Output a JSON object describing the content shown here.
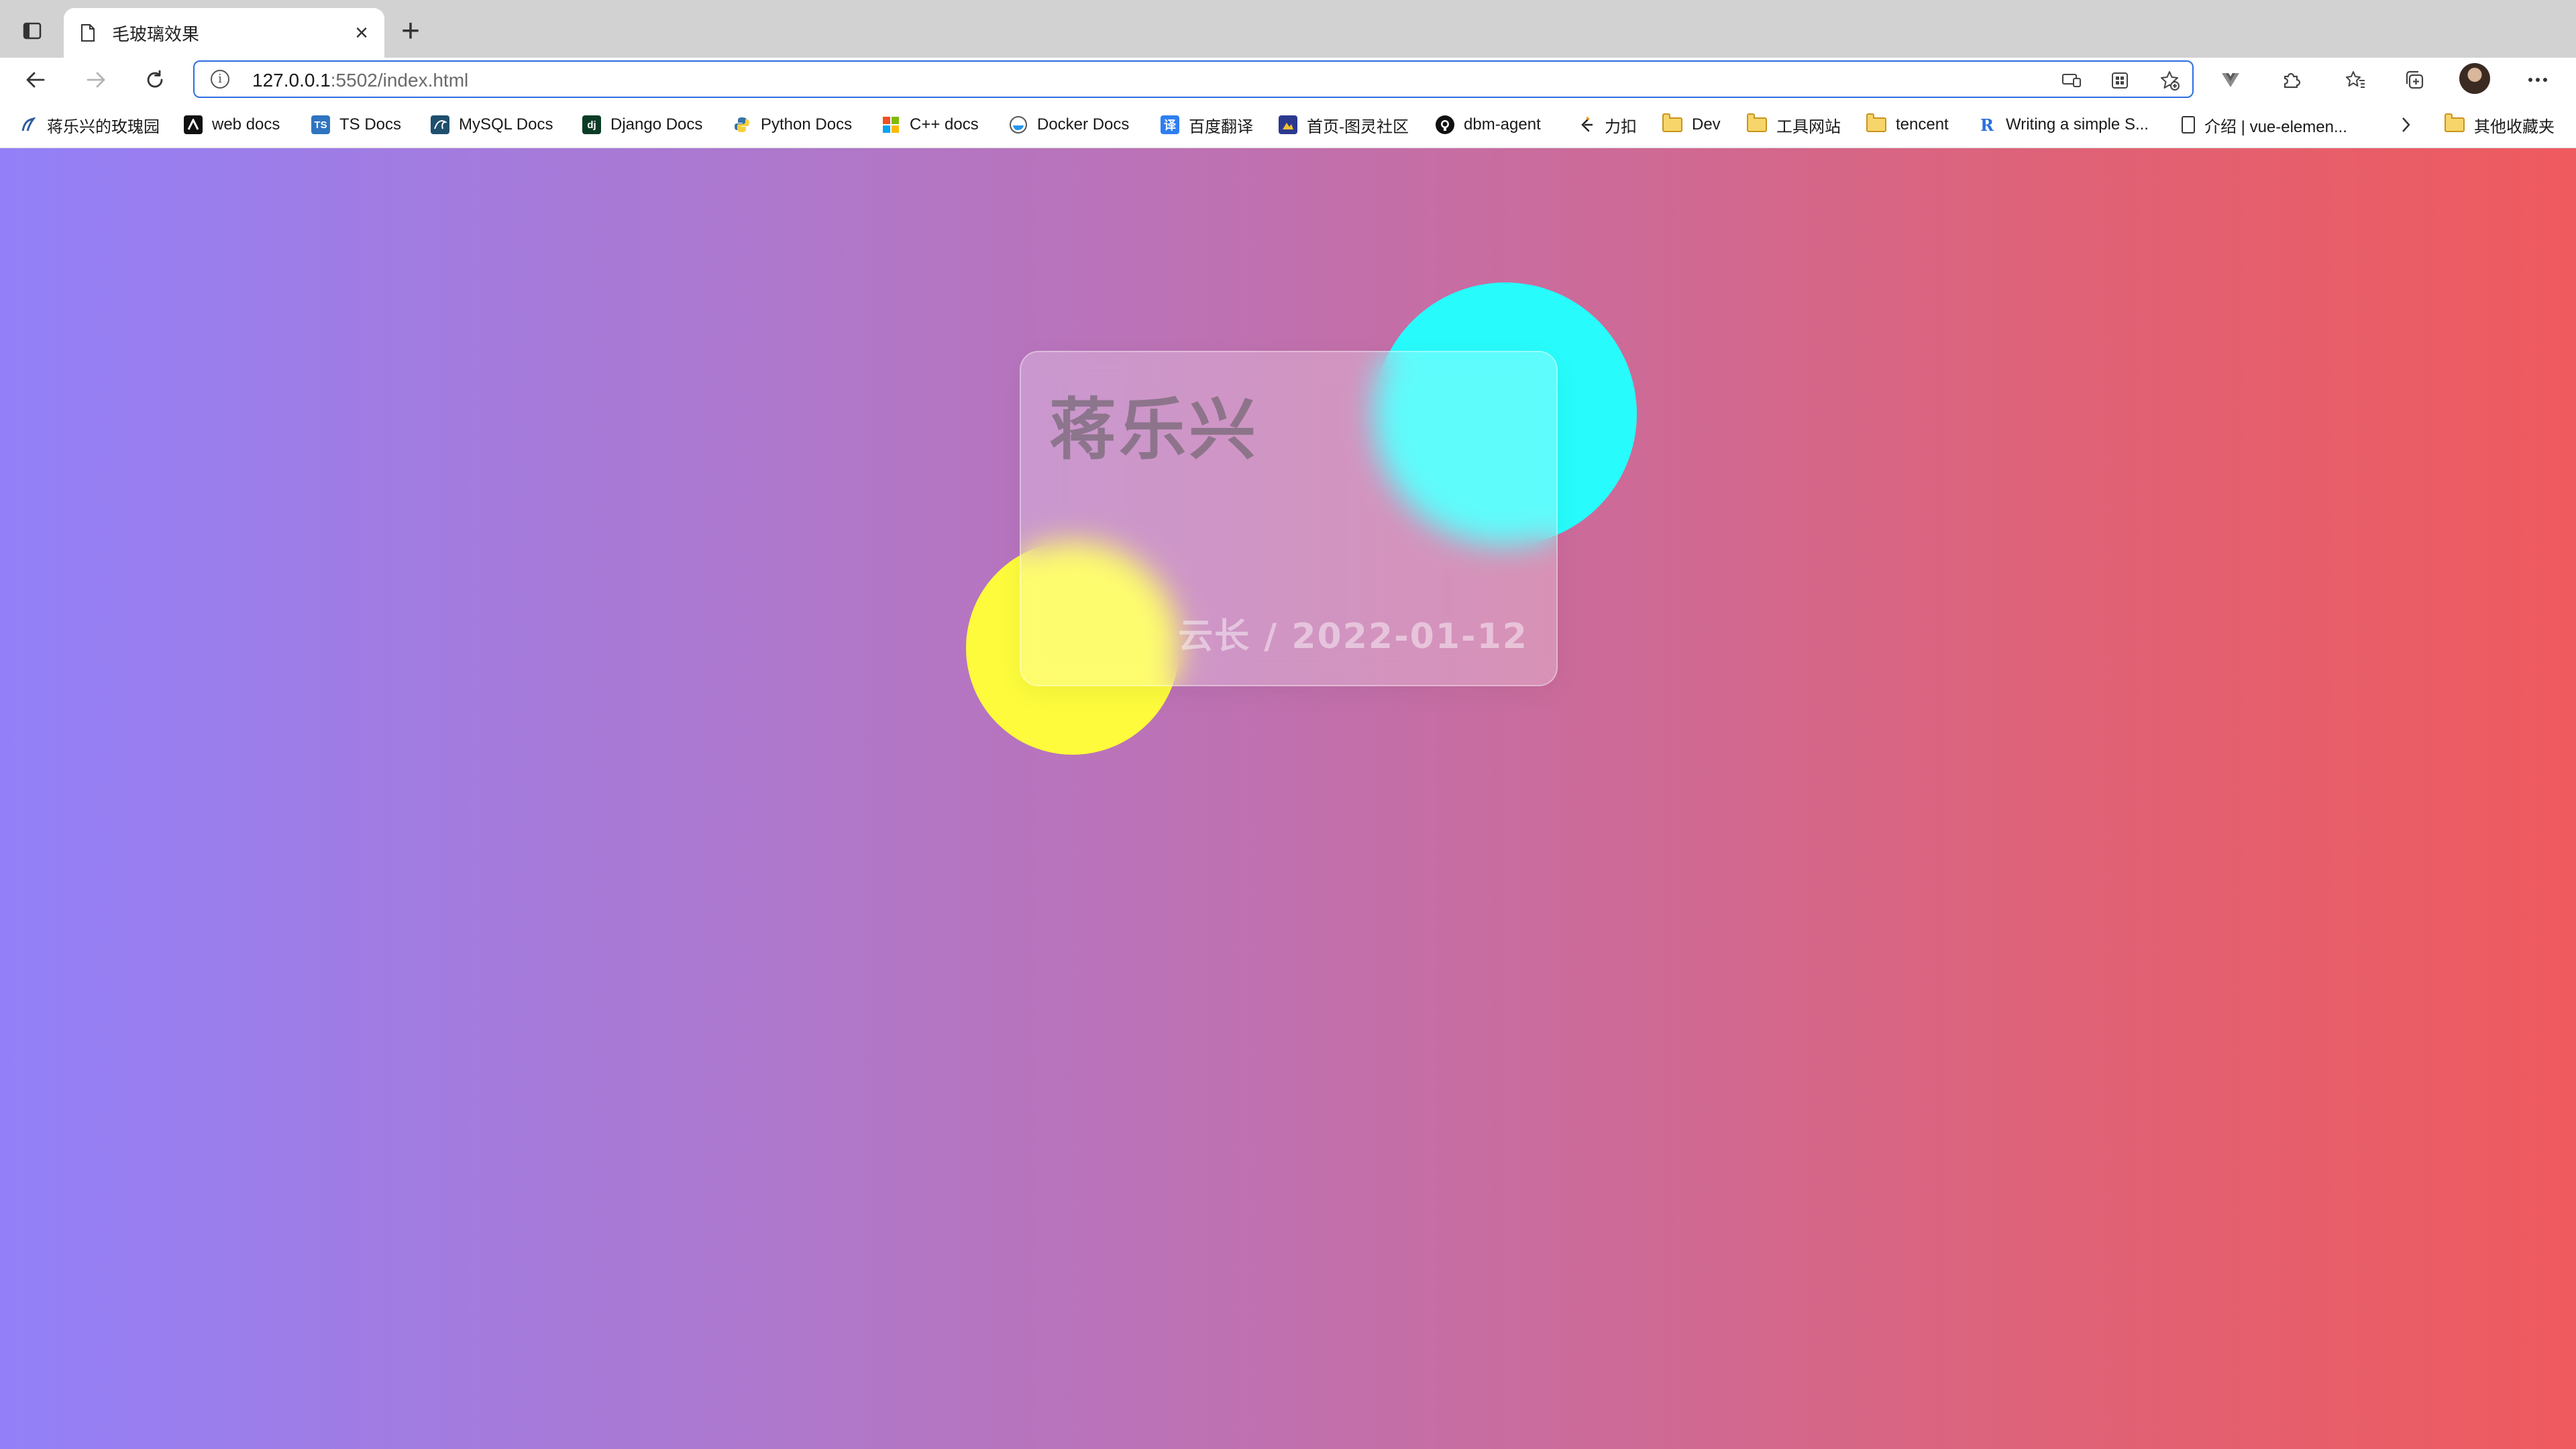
{
  "tab": {
    "title": "毛玻璃效果"
  },
  "address_bar": {
    "host": "127.0.0.1",
    "path": ":5502/index.html"
  },
  "bookmarks": [
    {
      "label": "蒋乐兴的玫瑰园",
      "icon": "blog-icon"
    },
    {
      "label": "web docs",
      "icon": "mdn-icon"
    },
    {
      "label": "TS Docs",
      "icon": "ts-icon"
    },
    {
      "label": "MySQL Docs",
      "icon": "mysql-icon"
    },
    {
      "label": "Django Docs",
      "icon": "django-icon"
    },
    {
      "label": "Python Docs",
      "icon": "python-icon"
    },
    {
      "label": "C++ docs",
      "icon": "microsoft-icon"
    },
    {
      "label": "Docker Docs",
      "icon": "docker-icon"
    },
    {
      "label": "百度翻译",
      "icon": "translate-icon"
    },
    {
      "label": "首页-图灵社区",
      "icon": "turing-icon"
    },
    {
      "label": "dbm-agent",
      "icon": "github-icon"
    },
    {
      "label": "力扣",
      "icon": "leetcode-icon"
    },
    {
      "label": "Dev",
      "icon": "folder-icon"
    },
    {
      "label": "工具网站",
      "icon": "folder-icon"
    },
    {
      "label": "tencent",
      "icon": "folder-icon"
    },
    {
      "label": "Writing a simple S...",
      "icon": "r-icon"
    },
    {
      "label": "介绍 | vue-elemen...",
      "icon": "document-icon"
    }
  ],
  "other_bookmarks": {
    "label": "其他收藏夹",
    "icon": "folder-icon"
  },
  "card": {
    "name": "蒋乐兴",
    "meta": "云长 / 2022-01-12"
  },
  "colors": {
    "gradient_start": "#9380f8",
    "gradient_end": "#ef5a5e",
    "circle_cyan": "#28fbfb",
    "circle_yellow": "#fdfb3c",
    "accent": "#2e6ee0"
  }
}
